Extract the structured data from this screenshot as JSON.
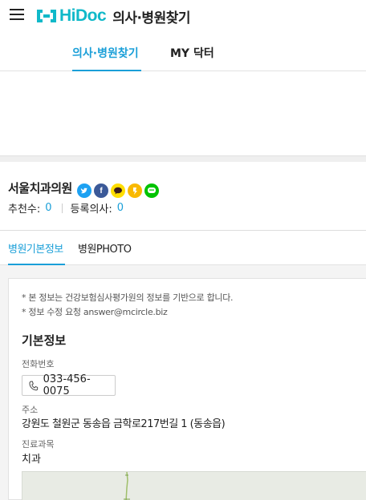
{
  "header": {
    "logo_text": "HiDoc",
    "subtitle": "의사·병원찾기"
  },
  "nav": {
    "tabs": [
      {
        "label": "의사·병원찾기",
        "active": true
      },
      {
        "label": "MY 닥터",
        "active": false
      }
    ]
  },
  "hospital": {
    "name": "서울치과의원",
    "share_icons": [
      "twitter-icon",
      "facebook-icon",
      "kakaotalk-icon",
      "kakaostory-icon",
      "line-icon"
    ],
    "recommend_label": "추천수:",
    "recommend_count": "0",
    "doctors_label": "등록의사:",
    "doctors_count": "0"
  },
  "subtabs": [
    {
      "label": "병원기본정보",
      "active": true
    },
    {
      "label": "병원PHOTO",
      "active": false
    }
  ],
  "info": {
    "notice1": "* 본 정보는 건강보험심사평가원의 정보를 기반으로 합니다.",
    "notice2": "* 정보 수정 요청 answer@mcircle.biz",
    "section_title": "기본정보",
    "phone_label": "전화번호",
    "phone": "033-456-0075",
    "address_label": "주소",
    "address": "강원도 철원군 동송읍 금학로217번길 1 (동송읍)",
    "dept_label": "진료과목",
    "dept": "치과"
  },
  "colors": {
    "brand": "#11b9c9",
    "accent": "#1a9fd8"
  }
}
